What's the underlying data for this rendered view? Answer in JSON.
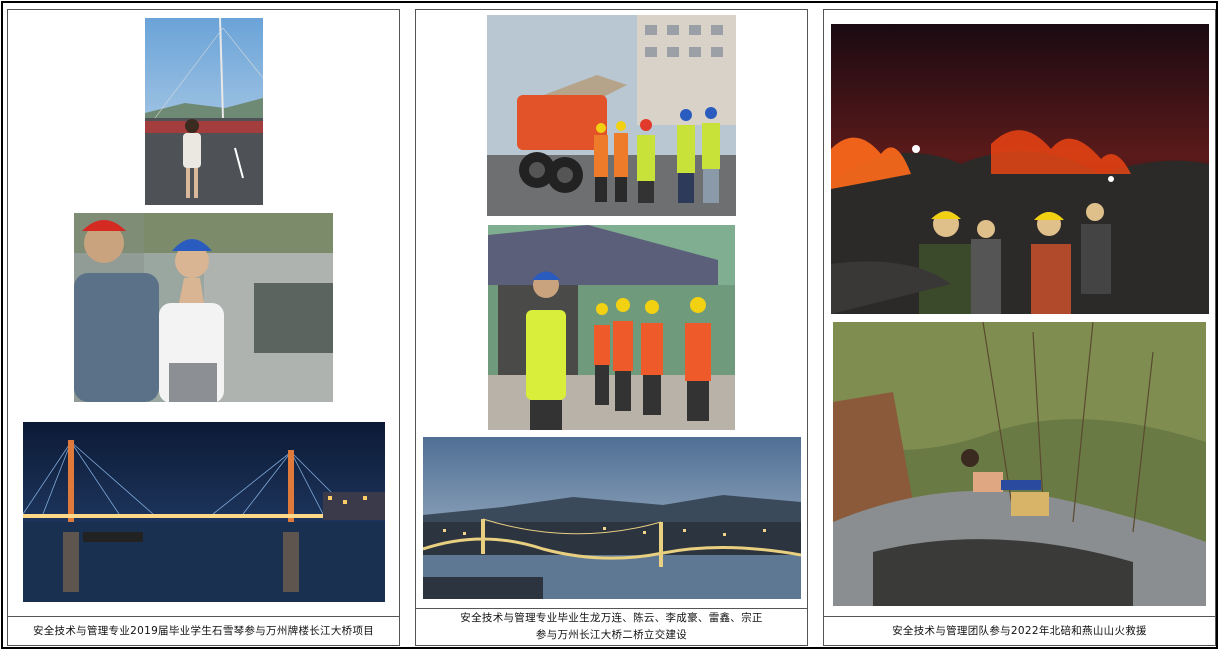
{
  "panels": [
    {
      "caption": "安全技术与管理专业2019届毕业学生石雪琴参与万州牌楼长江大桥项目"
    },
    {
      "caption_line1": "安全技术与管理专业毕业生龙万连、陈云、李成豪、雷鑫、宗正",
      "caption_line2": "参与万州长江大桥二桥立交建设"
    },
    {
      "caption": "安全技术与管理团队参与2022年北碚和燕山山火救援"
    }
  ],
  "colors": {
    "border": "#555555",
    "frame": "#000000"
  }
}
